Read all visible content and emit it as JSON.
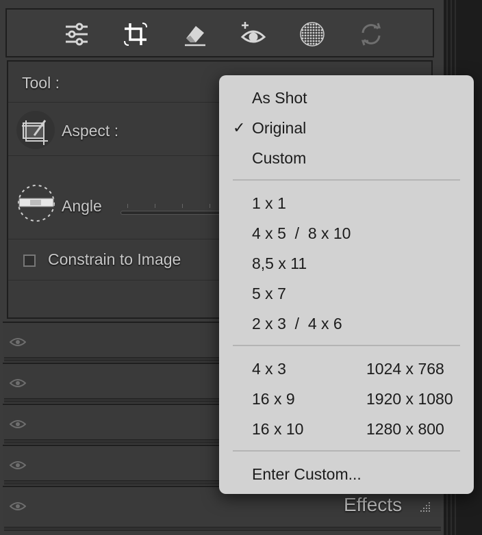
{
  "toolstrip": {
    "icons": [
      "sliders-icon",
      "crop-icon",
      "eraser-icon",
      "red-eye-icon",
      "mask-icon",
      "reset-icon"
    ]
  },
  "crop_panel": {
    "tool_label": "Tool :",
    "aspect_label": "Aspect :",
    "angle_label": "Angle",
    "constrain_label": "Constrain to Image",
    "constrain_checked": false
  },
  "effects_label": "Effects",
  "aspect_menu": {
    "section1": [
      {
        "label": "As Shot",
        "checked": false
      },
      {
        "label": "Original",
        "checked": true
      },
      {
        "label": "Custom",
        "checked": false
      }
    ],
    "section2": [
      "1 x 1",
      "4 x 5  /  8 x 10",
      "8,5 x 11",
      "5 x 7",
      "2 x 3  /  4 x 6"
    ],
    "section3": [
      {
        "ratio": "4 x 3",
        "size": "1024 x 768"
      },
      {
        "ratio": "16 x 9",
        "size": "1920 x 1080"
      },
      {
        "ratio": "16 x 10",
        "size": "1280 x 800"
      }
    ],
    "enter_custom": "Enter Custom...",
    "check_glyph": "✓"
  },
  "colors": {
    "panel": "#3b3b3b",
    "menu_bg": "#d2d2d2",
    "menu_text": "#1c1c1c",
    "label_text": "#c8c8c8"
  }
}
